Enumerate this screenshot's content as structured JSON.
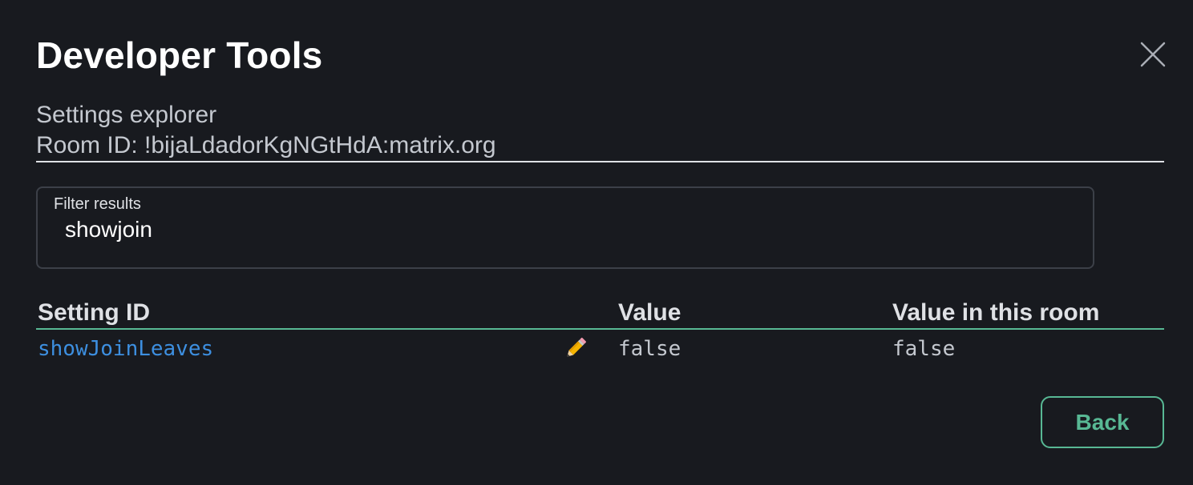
{
  "dialog": {
    "title": "Developer Tools",
    "close_icon": "close-icon"
  },
  "subheader": {
    "tool_name": "Settings explorer",
    "room_id": "Room ID: !bijaLdadorKgNGtHdA:matrix.org"
  },
  "filter": {
    "label": "Filter results",
    "value": "showjoin"
  },
  "table": {
    "columns": [
      "Setting ID",
      "Value",
      "Value in this room"
    ],
    "rows": [
      {
        "setting_id": "showJoinLeaves",
        "edit_icon": "pencil-icon",
        "value": "false",
        "value_in_room": "false"
      }
    ]
  },
  "footer": {
    "back_label": "Back"
  },
  "colors": {
    "background": "#181a1f",
    "accent": "#58b894",
    "link": "#3d8fe0",
    "border": "#3c4048"
  }
}
